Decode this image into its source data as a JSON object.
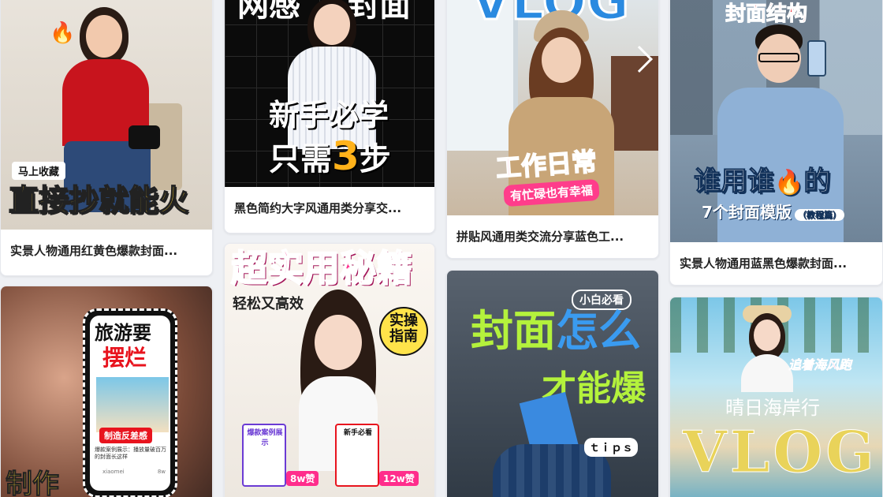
{
  "cards": [
    {
      "caption": "实景人物通用红黄色爆款封面...",
      "tag": "马上收藏",
      "headline": "直接抄就能火",
      "emoji": "🔥"
    },
    {
      "caption": "黑色简约大字风通用类分享交...",
      "top_text": "网感",
      "top_text2": "封面",
      "line1": "新手必学",
      "line2_a": "只需",
      "line2_num": "3",
      "line2_b": "步"
    },
    {
      "caption": "拼贴风通用类交流分享蓝色工...",
      "logo_text": "VLOG",
      "headline": "工作日常",
      "subline": "有忙碌也有幸福"
    },
    {
      "caption": "实景人物通用蓝黑色爆款封面...",
      "top_text": "封面结构",
      "headline_a": "谁用谁",
      "emoji": "🔥",
      "headline_b": "的",
      "subline": "7个封面模版",
      "subtag": "（教程篇）"
    },
    {
      "line1": "旅游要",
      "line2": "摆烂",
      "chip": "制造反差感",
      "note": "爆款案例展示：播放量破百万的封面长这样",
      "user": "xiaomei",
      "count": "8w",
      "bottom": "制作"
    },
    {
      "headline": "超实用秘籍",
      "subline": "轻松又高效",
      "bubble": "实操指南",
      "card_a_title": "爆款案例展示",
      "card_a_likes": "8w赞",
      "card_b_title": "新手必看",
      "card_b_likes": "12w赞"
    },
    {
      "tag": "小白必看",
      "line1_a": "封面",
      "line1_b": "怎么",
      "line2": "才能爆",
      "sticker": "ｔｉｐｓ"
    },
    {
      "tag": "追着海风跑",
      "title": "晴日海岸行",
      "logo": "VLOG"
    }
  ]
}
